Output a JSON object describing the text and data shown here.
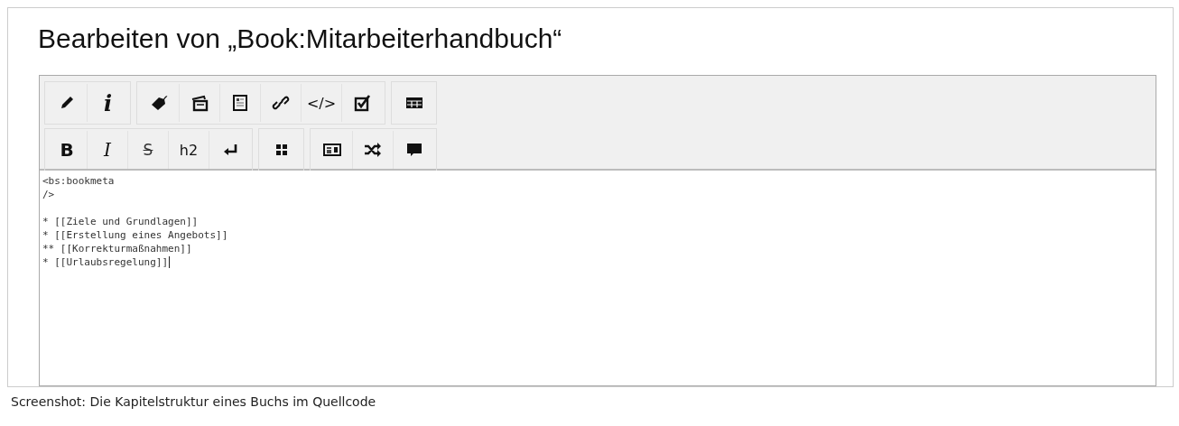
{
  "heading": "Bearbeiten von „Book:Mitarbeiterhandbuch“",
  "toolbar_rows": [
    [
      [
        {
          "kind": "pencil"
        },
        {
          "kind": "info",
          "label": "i"
        }
      ],
      [
        {
          "kind": "tag"
        },
        {
          "kind": "cards"
        },
        {
          "kind": "page"
        },
        {
          "kind": "link"
        },
        {
          "kind": "plain",
          "label": "</>"
        },
        {
          "kind": "checkbox"
        }
      ],
      [
        {
          "kind": "table"
        }
      ]
    ],
    [
      [
        {
          "kind": "bold",
          "label": "B"
        },
        {
          "kind": "italic",
          "label": "I"
        },
        {
          "kind": "strike",
          "label": "S"
        },
        {
          "kind": "plain",
          "label": "h2"
        },
        {
          "kind": "enter"
        }
      ],
      [
        {
          "kind": "grid"
        }
      ],
      [
        {
          "kind": "idcard"
        },
        {
          "kind": "shuffle"
        },
        {
          "kind": "comment"
        }
      ]
    ]
  ],
  "source_text": "<bs:bookmeta\n/>\n\n* [[Ziele und Grundlagen]]\n* [[Erstellung eines Angebots]]\n** [[Korrekturmaßnahmen]]\n* [[Urlaubsregelung]]",
  "caption": "Screenshot: Die Kapitelstruktur eines Buchs im Quellcode"
}
